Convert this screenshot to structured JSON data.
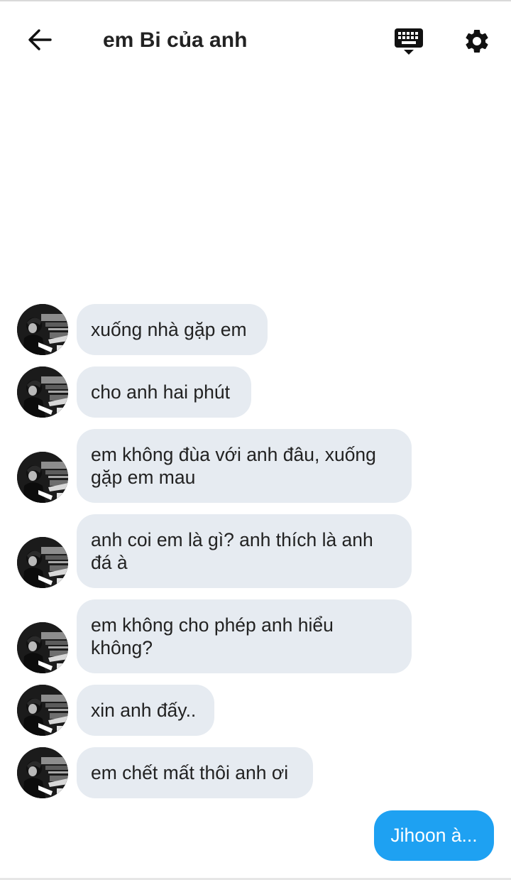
{
  "header": {
    "title": "em Bi của anh",
    "back_icon": "arrow-left-icon",
    "keyboard_icon": "keyboard-icon",
    "settings_icon": "gear-icon"
  },
  "messages": [
    {
      "direction": "incoming",
      "text": "xuống nhà gặp em"
    },
    {
      "direction": "incoming",
      "text": "cho anh hai phút"
    },
    {
      "direction": "incoming",
      "text": "em không đùa với anh đâu, xuống gặp em mau"
    },
    {
      "direction": "incoming",
      "text": "anh coi em là gì? anh thích là anh đá à"
    },
    {
      "direction": "incoming",
      "text": "em không cho phép anh hiểu không?"
    },
    {
      "direction": "incoming",
      "text": "xin anh đấy.."
    },
    {
      "direction": "incoming",
      "text": "em chết mất thôi anh ơi"
    },
    {
      "direction": "outgoing",
      "text": "Jihoon à..."
    }
  ],
  "colors": {
    "incoming_bubble": "#e6ebf1",
    "outgoing_bubble": "#1ea1f2",
    "text": "#222222"
  }
}
